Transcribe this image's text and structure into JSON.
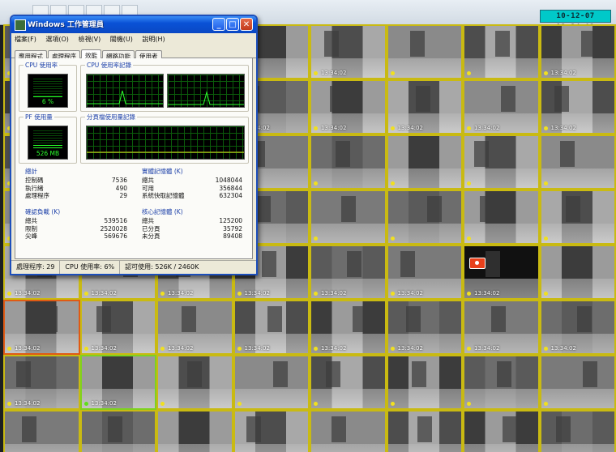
{
  "clock": "10-12-07  13:34:02",
  "task_manager": {
    "title": "Windows 工作管理員",
    "menu": [
      "檔案(F)",
      "選項(O)",
      "檢視(V)",
      "關機(U)",
      "說明(H)"
    ],
    "tabs": [
      "應用程式",
      "處理程序",
      "效能",
      "網路功能",
      "使用者"
    ],
    "active_tab": 2,
    "cpu_usage_label": "CPU 使用率",
    "cpu_usage_value": "6 %",
    "cpu_usage_level": 0.06,
    "cpu_history_label": "CPU 使用率記錄",
    "pf_usage_label": "PF 使用量",
    "pf_usage_value": "526 MB",
    "pf_usage_level": 0.21,
    "pf_history_label": "分頁檔使用量記錄",
    "totals": {
      "label": "總計",
      "rows": [
        {
          "name": "控制碼",
          "value": "7536"
        },
        {
          "name": "執行緒",
          "value": "490"
        },
        {
          "name": "處理程序",
          "value": "29"
        }
      ]
    },
    "physical_memory": {
      "label": "實體記憶體 (K)",
      "rows": [
        {
          "name": "總共",
          "value": "1048044"
        },
        {
          "name": "可用",
          "value": "356844"
        },
        {
          "name": "系統快取記憶體",
          "value": "632304"
        }
      ]
    },
    "commit_charge": {
      "label": "確認負載 (K)",
      "rows": [
        {
          "name": "總共",
          "value": "539516"
        },
        {
          "name": "限制",
          "value": "2520028"
        },
        {
          "name": "尖峰",
          "value": "569676"
        }
      ]
    },
    "kernel_memory": {
      "label": "核心記憶體 (K)",
      "rows": [
        {
          "name": "總共",
          "value": "125200"
        },
        {
          "name": "已分頁",
          "value": "35792"
        },
        {
          "name": "未分頁",
          "value": "89408"
        }
      ]
    },
    "status": {
      "processes": "處理程序: 29",
      "cpu": "CPU 使用率: 6%",
      "commit": "認可使用: 526K / 2460K"
    }
  },
  "cameras": [
    {
      "row": 0,
      "col": 3,
      "label": "",
      "time": ""
    },
    {
      "row": 0,
      "col": 4,
      "label": "",
      "time": "13:34:02"
    },
    {
      "row": 0,
      "col": 7,
      "label": "",
      "time": "13:34:02"
    },
    {
      "row": 1,
      "col": 3,
      "label": "",
      "time": "13:34:02"
    },
    {
      "row": 1,
      "col": 4,
      "label": "",
      "time": "13:34:02"
    },
    {
      "row": 1,
      "col": 5,
      "label": "",
      "time": "13:34:02"
    },
    {
      "row": 1,
      "col": 6,
      "label": "",
      "time": "13:34:02"
    },
    {
      "row": 1,
      "col": 7,
      "label": "",
      "time": "13:34:02"
    },
    {
      "row": 4,
      "col": 0,
      "label": "",
      "time": "13:34:02"
    },
    {
      "row": 4,
      "col": 1,
      "label": "",
      "time": "13:34:02"
    },
    {
      "row": 4,
      "col": 2,
      "label": "",
      "time": "13:34:02"
    },
    {
      "row": 4,
      "col": 3,
      "label": "",
      "time": "13:34:02"
    },
    {
      "row": 4,
      "col": 4,
      "label": "",
      "time": "13:34:02"
    },
    {
      "row": 4,
      "col": 5,
      "label": "",
      "time": "13:34:02"
    },
    {
      "row": 4,
      "col": 6,
      "label": "",
      "time": "13:34:02"
    },
    {
      "row": 5,
      "col": 0,
      "label": "",
      "time": "13:34:02"
    },
    {
      "row": 5,
      "col": 1,
      "label": "",
      "time": "13:34:02"
    },
    {
      "row": 5,
      "col": 2,
      "label": "",
      "time": "13:34:02"
    },
    {
      "row": 5,
      "col": 3,
      "label": "",
      "time": "13:34:02"
    },
    {
      "row": 5,
      "col": 4,
      "label": "",
      "time": "13:34:02"
    },
    {
      "row": 5,
      "col": 5,
      "label": "",
      "time": "13:34:02"
    },
    {
      "row": 5,
      "col": 6,
      "label": "",
      "time": "13:34:02"
    },
    {
      "row": 5,
      "col": 7,
      "label": "",
      "time": "13:34:02"
    },
    {
      "row": 6,
      "col": 0,
      "label": "",
      "time": "13:34:02"
    },
    {
      "row": 6,
      "col": 1,
      "label": "",
      "time": "13:34:02"
    }
  ],
  "colors": {
    "tile_border": "#c9ba12",
    "selected_border": "#e05a14",
    "green_border": "#7ed21e",
    "clock_bg": "#00c9c9",
    "meter_green": "#27ff27"
  }
}
